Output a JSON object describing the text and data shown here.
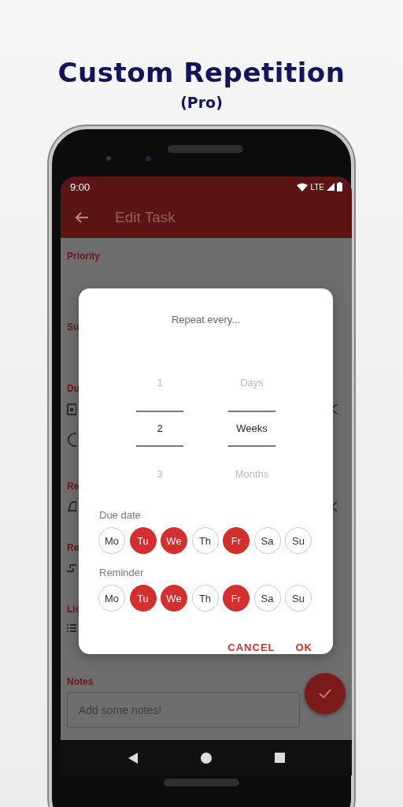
{
  "headline": {
    "title": "Custom Repetition",
    "subtitle": "(Pro)"
  },
  "status_bar": {
    "time": "9:00",
    "network": "LTE"
  },
  "app_bar": {
    "title": "Edit Task"
  },
  "background": {
    "labels": [
      "Priority",
      "Su",
      "Du",
      "Re",
      "Re",
      "Lis",
      "Notes"
    ],
    "notes": {
      "placeholder": "Add some notes!"
    }
  },
  "dialog": {
    "title": "Repeat every...",
    "numbers": [
      {
        "label": "1",
        "selected": false
      },
      {
        "label": "2",
        "selected": true
      },
      {
        "label": "3",
        "selected": false
      }
    ],
    "units": [
      {
        "label": "Days",
        "selected": false
      },
      {
        "label": "Weeks",
        "selected": true
      },
      {
        "label": "Months",
        "selected": false
      }
    ],
    "groups": [
      {
        "label": "Due date",
        "days": [
          {
            "label": "Mo",
            "selected": false
          },
          {
            "label": "Tu",
            "selected": true
          },
          {
            "label": "We",
            "selected": true
          },
          {
            "label": "Th",
            "selected": false
          },
          {
            "label": "Fr",
            "selected": true
          },
          {
            "label": "Sa",
            "selected": false
          },
          {
            "label": "Su",
            "selected": false
          }
        ]
      },
      {
        "label": "Reminder",
        "days": [
          {
            "label": "Mo",
            "selected": false
          },
          {
            "label": "Tu",
            "selected": true
          },
          {
            "label": "We",
            "selected": true
          },
          {
            "label": "Th",
            "selected": false
          },
          {
            "label": "Fr",
            "selected": true
          },
          {
            "label": "Sa",
            "selected": false
          },
          {
            "label": "Su",
            "selected": false
          }
        ]
      }
    ],
    "buttons": [
      "CANCEL",
      "OK"
    ]
  }
}
